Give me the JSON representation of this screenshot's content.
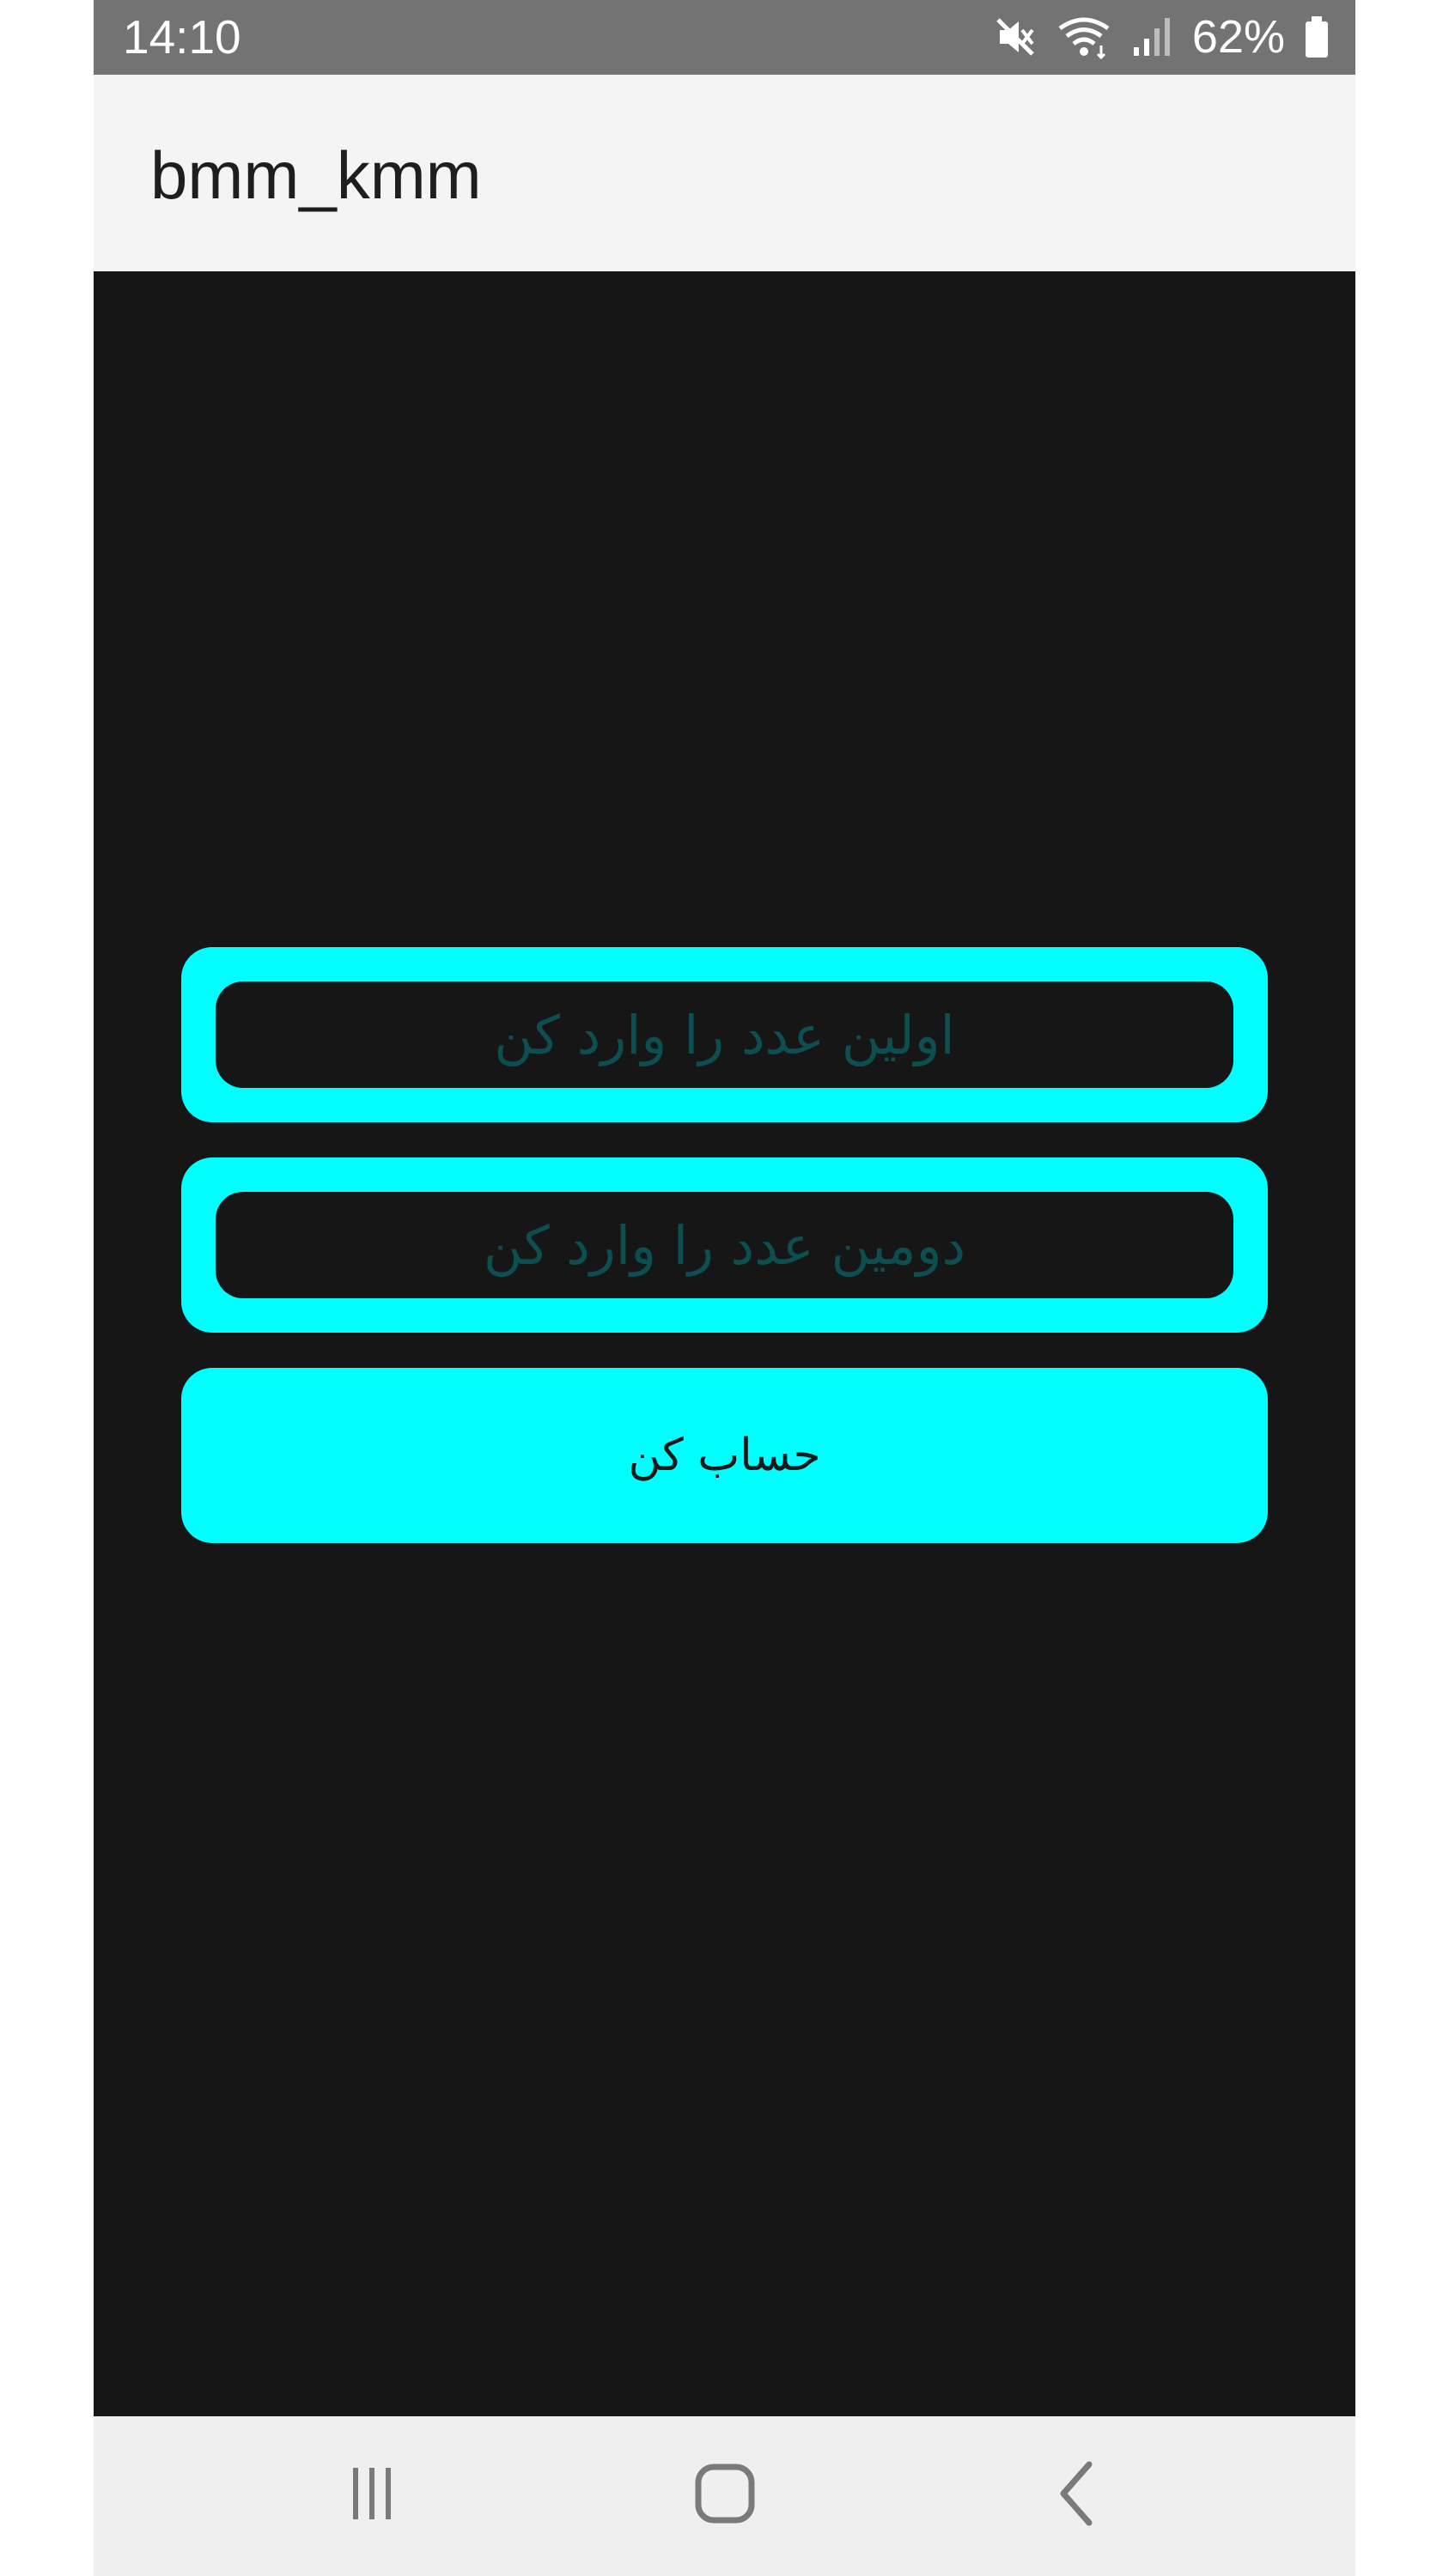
{
  "status_bar": {
    "time": "14:10",
    "battery_percent": "62%",
    "icons": [
      "mute-icon",
      "wifi-icon",
      "signal-icon",
      "battery-icon"
    ]
  },
  "app_bar": {
    "title": "bmm_kmm"
  },
  "form": {
    "first_number_placeholder": "اولین عدد را وارد کن",
    "first_number_value": "",
    "second_number_placeholder": "دومین عدد را وارد کن",
    "second_number_value": "",
    "calculate_label": "حساب کن"
  },
  "navigation": {
    "icons": [
      "recents-icon",
      "home-icon",
      "back-icon"
    ]
  },
  "colors": {
    "accent": "#00ffff",
    "background": "#161616",
    "status_bar": "#737373",
    "app_bar": "#f4f4f4",
    "nav_bar": "#efefef"
  }
}
